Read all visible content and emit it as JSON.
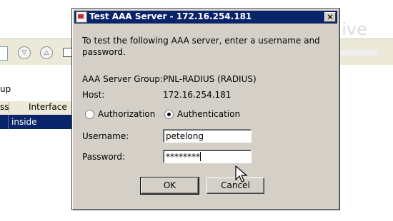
{
  "background": {
    "toolbar_buttons": [
      "▽",
      "△"
    ],
    "section_label": "up",
    "table": {
      "columns": [
        "ss",
        "Interface"
      ],
      "rows": [
        {
          "interface": "inside"
        }
      ]
    },
    "watermark": "petenetlive"
  },
  "dialog": {
    "title": "Test AAA Server - 172.16.254.181",
    "close_label": "×",
    "instructions": "To test the following AAA server, enter a username and password.",
    "server_group_label": "AAA Server Group:",
    "server_group_value": "PNL-RADIUS (RADIUS)",
    "host_label": "Host:",
    "host_value": "172.16.254.181",
    "radio_authorization": "Authorization",
    "radio_authentication": "Authentication",
    "selected_test": "Authentication",
    "username_label": "Username:",
    "username_value": "petelong",
    "password_label": "Password:",
    "password_value": "********",
    "ok_label": "OK",
    "cancel_label": "Cancel"
  },
  "colors": {
    "titlebar": "#0a246a",
    "dialog_face": "#d4d0c8",
    "selection": "#0a246a"
  }
}
